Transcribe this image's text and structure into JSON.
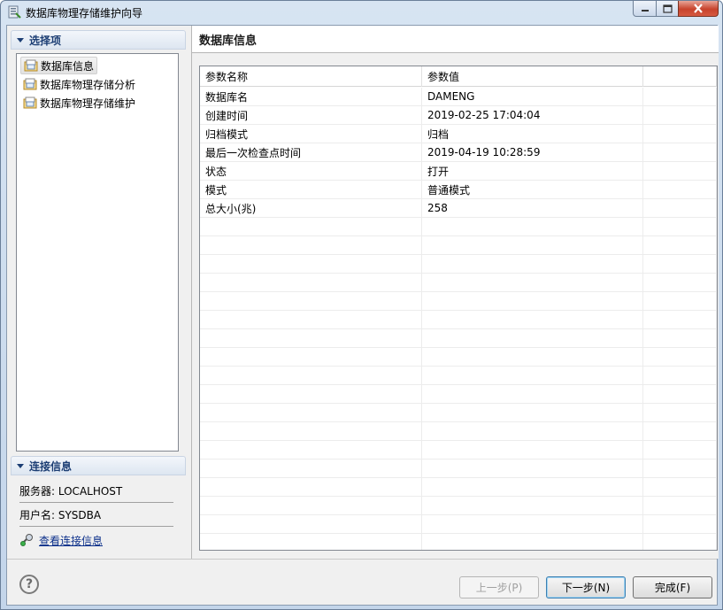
{
  "window": {
    "title": "数据库物理存储维护向导"
  },
  "left": {
    "select_section_title": "选择项",
    "tree_items": [
      {
        "label": "数据库信息",
        "selected": true
      },
      {
        "label": "数据库物理存储分析",
        "selected": false
      },
      {
        "label": "数据库物理存储维护",
        "selected": false
      }
    ],
    "conn_section_title": "连接信息",
    "server_text": "服务器: LOCALHOST",
    "user_text": "用户名: SYSDBA",
    "view_conn_link": "查看连接信息"
  },
  "right": {
    "header_title": "数据库信息",
    "columns": [
      "参数名称",
      "参数值",
      ""
    ],
    "rows": [
      {
        "name": "数据库名",
        "value": "DAMENG"
      },
      {
        "name": "创建时间",
        "value": "2019-02-25 17:04:04"
      },
      {
        "name": "归档模式",
        "value": "归档"
      },
      {
        "name": "最后一次检查点时间",
        "value": "2019-04-19 10:28:59"
      },
      {
        "name": "状态",
        "value": "打开"
      },
      {
        "name": "模式",
        "value": "普通模式"
      },
      {
        "name": "总大小(兆)",
        "value": "258"
      }
    ]
  },
  "buttons": {
    "prev": "上一步(P)",
    "next": "下一步(N)",
    "finish": "完成(F)"
  },
  "icons": {
    "app": "wizard-icon",
    "help": "help-icon",
    "tree_item": "database-folder-icon",
    "link": "connection-icon"
  }
}
